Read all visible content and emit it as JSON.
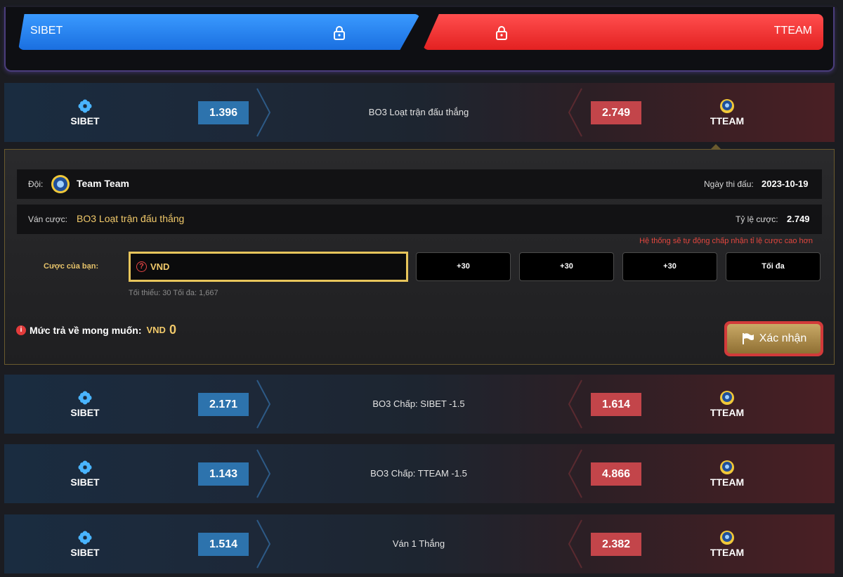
{
  "header": {
    "team_left": "SIBET",
    "team_right": "TTEAM"
  },
  "markets": [
    {
      "home": "SIBET",
      "home_odds": "1.396",
      "label": "BO3 Loạt trận đấu thắng",
      "away": "TTEAM",
      "away_odds": "2.749"
    },
    {
      "home": "SIBET",
      "home_odds": "2.171",
      "label": "BO3 Chấp: SIBET -1.5",
      "away": "TTEAM",
      "away_odds": "1.614"
    },
    {
      "home": "SIBET",
      "home_odds": "1.143",
      "label": "BO3 Chấp: TTEAM -1.5",
      "away": "TTEAM",
      "away_odds": "4.866"
    },
    {
      "home": "SIBET",
      "home_odds": "1.514",
      "label": "Ván 1 Thắng",
      "away": "TTEAM",
      "away_odds": "2.382"
    }
  ],
  "bet_slip": {
    "team_label": "Đội:",
    "team_name": "Team Team",
    "date_label": "Ngày thi đấu:",
    "date_value": "2023-10-19",
    "market_label": "Ván cược:",
    "market_value": "BO3 Loạt trận đấu thắng",
    "odds_label": "Tỷ lệ cược:",
    "odds_value": "2.749",
    "auto_accept_notice": "Hệ thống sẽ tự động chấp nhận tỉ lệ cược cao hơn",
    "your_bet_label": "Cược của bạn:",
    "amount_placeholder": "VND",
    "quick_buttons": [
      "+30",
      "+30",
      "+30",
      "Tối đa"
    ],
    "limits": "Tối thiểu: 30   Tối đa: 1,667",
    "payout_label": "Mức trả về mong muốn:",
    "payout_currency": "VND",
    "payout_amount": "0",
    "confirm_label": "Xác nhận"
  },
  "colors": {
    "blue_accent": "#2d73ad",
    "red_accent": "#c3454a",
    "gold_accent": "#f1c96a"
  }
}
